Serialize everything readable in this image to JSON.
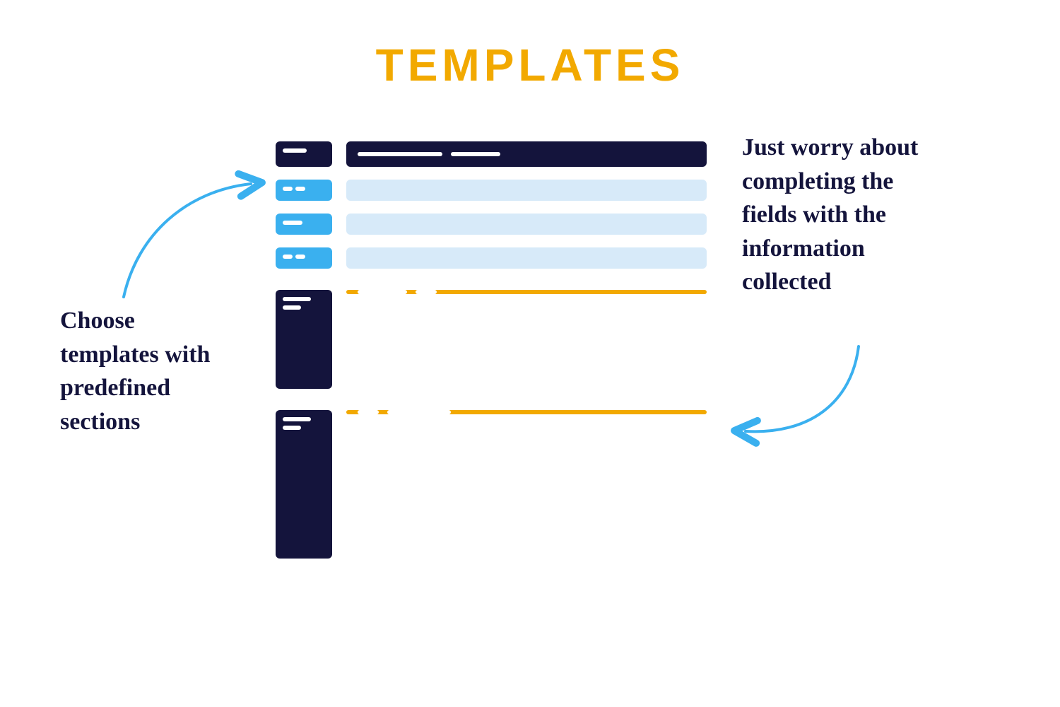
{
  "title": "TEMPLATES",
  "captions": {
    "left": "Choose templates with predefined sections",
    "right": "Just worry about completing the fields with the information collected"
  },
  "colors": {
    "title_accent": "#f2a900",
    "navy": "#14143c",
    "sky_blue": "#3ab0ef",
    "light_blue": "#d7eaf9",
    "orange": "#f2a900",
    "arrow": "#3ab0ef"
  }
}
